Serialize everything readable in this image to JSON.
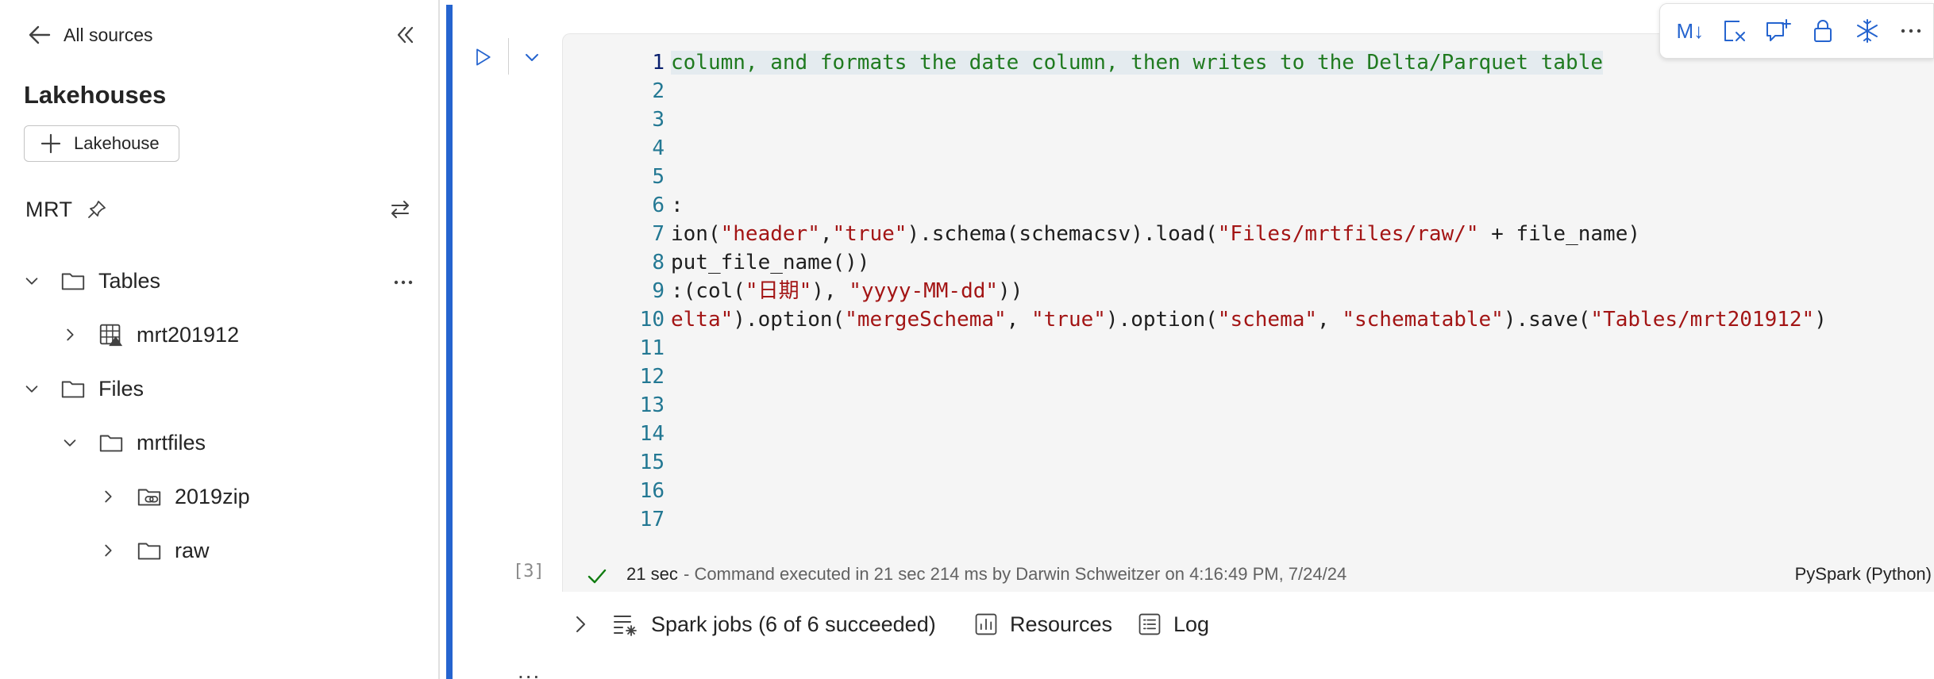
{
  "sidebar": {
    "back_label": "All sources",
    "section_title": "Lakehouses",
    "add_label": "Lakehouse",
    "lakehouse_name": "MRT",
    "tree": {
      "tables": {
        "label": "Tables",
        "items": [
          {
            "label": "mrt201912"
          }
        ]
      },
      "files": {
        "label": "Files",
        "folders": [
          {
            "label": "mrtfiles",
            "children": [
              {
                "label": "2019zip"
              },
              {
                "label": "raw"
              }
            ]
          }
        ]
      }
    }
  },
  "cell": {
    "execution_count": "[3]",
    "line_numbers": [
      "1",
      "2",
      "3",
      "4",
      "5",
      "6",
      "7",
      "8",
      "9",
      "10",
      "11",
      "12",
      "13",
      "14",
      "15",
      "16",
      "17"
    ],
    "code": {
      "l1": "column, and formats the date column, then writes to the Delta/Parquet table",
      "l6": ":",
      "l7a": "ion(",
      "l7b": "\"header\"",
      "l7c": ",",
      "l7d": "\"true\"",
      "l7e": ").schema(schemacsv).load(",
      "l7f": "\"Files/mrtfiles/raw/\"",
      "l7g": " + file_name)",
      "l8": "put_file_name())",
      "l9a": ":(col(",
      "l9b": "\"日期\"",
      "l9c": "), ",
      "l9d": "\"yyyy-MM-dd\"",
      "l9e": "))",
      "l10a": "elta\"",
      "l10b": ").option(",
      "l10c": "\"mergeSchema\"",
      "l10d": ", ",
      "l10e": "\"true\"",
      "l10f": ").option(",
      "l10g": "\"schema\"",
      "l10h": ", ",
      "l10i": "\"schematable\"",
      "l10j": ").save(",
      "l10k": "\"Tables/mrt201912\"",
      "l10l": ")"
    },
    "status": {
      "duration": "21 sec",
      "message": "- Command executed in 21 sec 214 ms by Darwin Schweitzer on 4:16:49 PM, 7/24/24",
      "language": "PySpark (Python)"
    },
    "toolbar": {
      "markdown_label": "M↓"
    }
  },
  "output": {
    "spark_jobs": "Spark jobs (6 of 6 succeeded)",
    "resources": "Resources",
    "log": "Log",
    "more": "..."
  },
  "colors": {
    "accent": "#2564cf",
    "comment": "#1f7a1f",
    "string": "#a31515",
    "line_number": "#237893",
    "success": "#107c10"
  }
}
